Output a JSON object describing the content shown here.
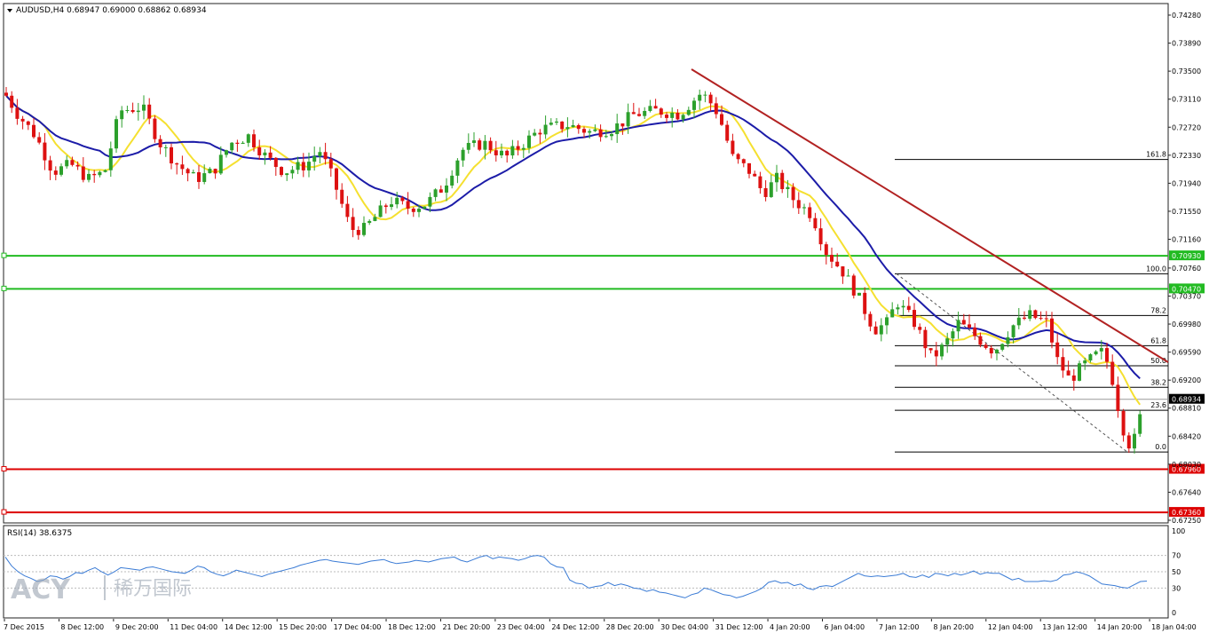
{
  "chart_data": {
    "type": "candlestick",
    "symbol_line": "AUDUSD,H4  0.68947 0.69000 0.68862 0.68934",
    "price_axis_ticks": [
      "0.74280",
      "0.73890",
      "0.73500",
      "0.73110",
      "0.72720",
      "0.72330",
      "0.71940",
      "0.71550",
      "0.71160",
      "0.70760",
      "0.70370",
      "0.69980",
      "0.69590",
      "0.69200",
      "0.68810",
      "0.68420",
      "0.68030",
      "0.67640",
      "0.67250"
    ],
    "price_range": [
      0.6725,
      0.7428
    ],
    "time_axis_labels": [
      "7 Dec 2015",
      "8 Dec 12:00",
      "9 Dec 20:00",
      "11 Dec 04:00",
      "14 Dec 12:00",
      "15 Dec 20:00",
      "17 Dec 04:00",
      "18 Dec 12:00",
      "21 Dec 20:00",
      "23 Dec 04:00",
      "24 Dec 12:00",
      "28 Dec 20:00",
      "30 Dec 04:00",
      "31 Dec 12:00",
      "4 Jan 20:00",
      "6 Jan 04:00",
      "7 Jan 12:00",
      "8 Jan 20:00",
      "12 Jan 04:00",
      "13 Jan 12:00",
      "14 Jan 20:00",
      "18 Jan 04:00"
    ],
    "current_price": "0.68934",
    "horizontal_levels": [
      {
        "label": "0.70930",
        "price": 0.7093,
        "color": "#22bb22"
      },
      {
        "label": "0.70470",
        "price": 0.7047,
        "color": "#22bb22"
      },
      {
        "label": "0.67960",
        "price": 0.6796,
        "color": "#dd0000"
      },
      {
        "label": "0.67360",
        "price": 0.6736,
        "color": "#dd0000"
      }
    ],
    "fibonacci": [
      {
        "label": "161.8",
        "price": 0.7227
      },
      {
        "label": "100.0",
        "price": 0.7068
      },
      {
        "label": "78.2",
        "price": 0.701
      },
      {
        "label": "61.8",
        "price": 0.6968
      },
      {
        "label": "50.0",
        "price": 0.694
      },
      {
        "label": "38.2",
        "price": 0.691
      },
      {
        "label": "23.6",
        "price": 0.6878
      },
      {
        "label": "0.0",
        "price": 0.682
      }
    ],
    "ma_colors": {
      "fast": "#f5e030",
      "slow": "#1c1ca8",
      "trend": "#b22222"
    },
    "candle_colors": {
      "up": "#2ca02c",
      "down": "#dd1111"
    },
    "rsi": {
      "label": "RSI(14) 38.6375",
      "ticks": [
        "100",
        "70",
        "50",
        "30",
        "0"
      ],
      "levels": [
        70,
        50,
        30
      ],
      "values": [
        68,
        57,
        50,
        45,
        42,
        38,
        40,
        45,
        44,
        41,
        44,
        49,
        48,
        52,
        55,
        50,
        46,
        50,
        55,
        54,
        53,
        52,
        55,
        56,
        54,
        52,
        50,
        49,
        48,
        52,
        57,
        55,
        50,
        47,
        45,
        48,
        52,
        50,
        48,
        46,
        44,
        47,
        49,
        51,
        53,
        55,
        58,
        60,
        62,
        64,
        65,
        63,
        62,
        61,
        60,
        59,
        61,
        63,
        64,
        65,
        62,
        60,
        61,
        62,
        64,
        63,
        62,
        64,
        66,
        67,
        68,
        64,
        62,
        65,
        68,
        70,
        66,
        68,
        67,
        66,
        64,
        66,
        69,
        70,
        68,
        60,
        56,
        55,
        40,
        36,
        35,
        30,
        32,
        33,
        37,
        33,
        35,
        33,
        30,
        29,
        26,
        28,
        25,
        24,
        22,
        20,
        18,
        22,
        24,
        30,
        28,
        25,
        22,
        21,
        18,
        20,
        23,
        26,
        30,
        37,
        39,
        36,
        37,
        33,
        35,
        30,
        28,
        32,
        33,
        32,
        36,
        40,
        44,
        48,
        45,
        44,
        45,
        44,
        45,
        46,
        48,
        44,
        43,
        46,
        43,
        48,
        47,
        45,
        48,
        46,
        48,
        51,
        47,
        49,
        48,
        48,
        44,
        40,
        42,
        38,
        38,
        38,
        39,
        38,
        40,
        46,
        47,
        50,
        48,
        45,
        40,
        35,
        34,
        33,
        31,
        30,
        34,
        38,
        38.6
      ]
    },
    "logo_text": "ACY",
    "logo_cn": "稀万国际"
  }
}
